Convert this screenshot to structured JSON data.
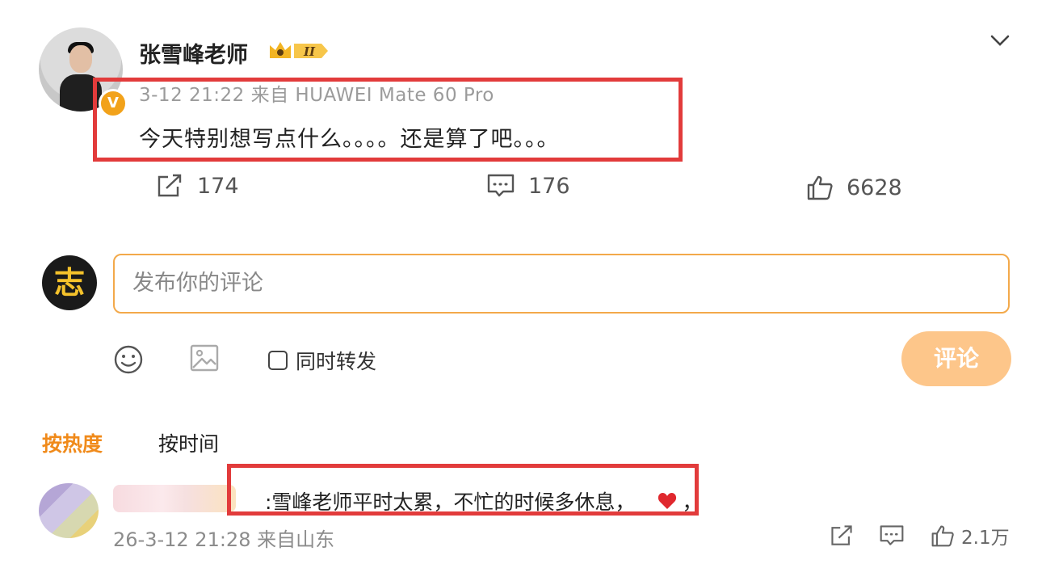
{
  "post": {
    "username": "张雪峰老师",
    "level_badge": "II",
    "timestamp": "3-12 21:22",
    "source": "来自 HUAWEI Mate 60 Pro",
    "text": "今天特别想写点什么。。。。还是算了吧。。。",
    "counts": {
      "reposts": "174",
      "comments": "176",
      "likes": "6628"
    },
    "verified_mark": "V"
  },
  "composer": {
    "avatar_char": "志",
    "placeholder": "发布你的评论",
    "repost_label": "同时转发",
    "submit_label": "评论"
  },
  "sort": {
    "hot": "按热度",
    "time": "按时间"
  },
  "reply": {
    "text": ":雪峰老师平时太累，不忙的时候多休息，",
    "trailing": "，",
    "meta": "26-3-12 21:28 来自山东",
    "likes": "2.1万"
  },
  "colors": {
    "highlight": "#e23b3b",
    "accent": "#f08a1a",
    "submit_bg": "#fdc68a",
    "input_border": "#f3a94a"
  },
  "icons": [
    "chevron-down-icon",
    "verified-icon",
    "crown-badge-icon",
    "share-icon",
    "comment-icon",
    "like-icon",
    "emoji-icon",
    "image-icon",
    "heart-icon"
  ]
}
